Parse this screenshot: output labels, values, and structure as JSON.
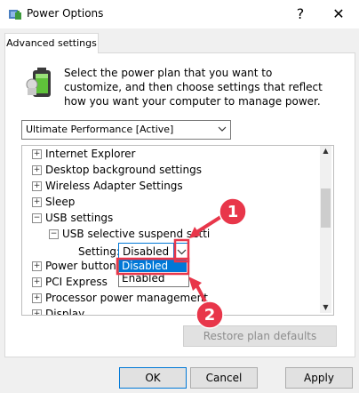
{
  "window": {
    "title": "Power Options",
    "help_glyph": "?",
    "close_glyph": "✕"
  },
  "tab": {
    "label": "Advanced settings"
  },
  "description": "Select the power plan that you want to customize, and then choose settings that reflect how you want your computer to manage power.",
  "plan_select": {
    "value": "Ultimate Performance [Active]"
  },
  "tree": {
    "items": [
      {
        "label": "Internet Explorer",
        "expander": "+"
      },
      {
        "label": "Desktop background settings",
        "expander": "+"
      },
      {
        "label": "Wireless Adapter Settings",
        "expander": "+"
      },
      {
        "label": "Sleep",
        "expander": "+"
      },
      {
        "label": "USB settings",
        "expander": "−"
      },
      {
        "label": "USB selective suspend setti",
        "expander": "−"
      },
      {
        "label": "Power buttons",
        "expander": "+"
      },
      {
        "label": "PCI Express",
        "expander": "+"
      },
      {
        "label": "Processor power management",
        "expander": "+"
      },
      {
        "label": "Display",
        "expander": "+"
      }
    ],
    "setting_label": "Setting:",
    "setting_value": "Disabled",
    "dropdown_options": [
      "Disabled",
      "Enabled"
    ]
  },
  "restore_button": "Restore plan defaults",
  "buttons": {
    "ok": "OK",
    "cancel": "Cancel",
    "apply": "Apply"
  },
  "annotations": {
    "badge1": "1",
    "badge2": "2",
    "color": "#e8364a"
  }
}
